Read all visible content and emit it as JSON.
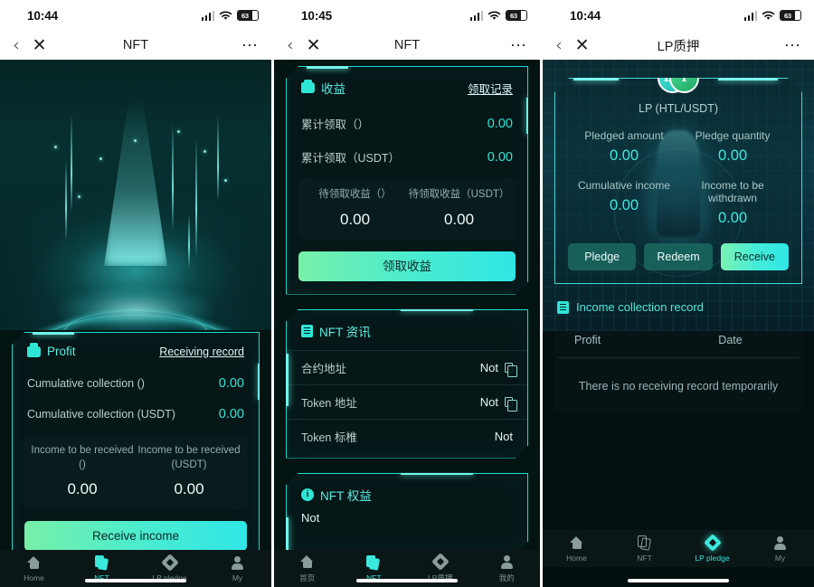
{
  "panels": [
    {
      "statusbar": {
        "time": "10:44",
        "battery": "63",
        "wifi_icon": "wifi-icon",
        "signal_icon": "signal-bars-icon"
      },
      "nav": {
        "back_icon": "chevron-left-icon",
        "close_icon": "close-x-icon",
        "title": "NFT",
        "more_icon": "more-dots-icon"
      },
      "profit_card": {
        "icon": "wallet-icon",
        "title": "Profit",
        "record_link": "Receiving record",
        "rows": [
          {
            "label": "Cumulative collection ()",
            "value": "0.00"
          },
          {
            "label": "Cumulative collection (USDT)",
            "value": "0.00"
          }
        ],
        "pending": [
          {
            "label": "Income to be received ()",
            "value": "0.00"
          },
          {
            "label": "Income to be received (USDT)",
            "value": "0.00"
          }
        ],
        "cta": "Receive income"
      },
      "tabs": [
        {
          "label": "Home",
          "icon": "home-icon",
          "active": false
        },
        {
          "label": "NFT",
          "icon": "nft-cards-icon",
          "active": true
        },
        {
          "label": "LP pledge",
          "icon": "lp-diamond-icon",
          "active": false
        },
        {
          "label": "My",
          "icon": "person-icon",
          "active": false
        }
      ]
    },
    {
      "statusbar": {
        "time": "10:45",
        "battery": "63",
        "wifi_icon": "wifi-icon",
        "signal_icon": "signal-bars-icon"
      },
      "nav": {
        "back_icon": "chevron-left-icon",
        "close_icon": "close-x-icon",
        "title": "NFT",
        "more_icon": "more-dots-icon"
      },
      "profit_card": {
        "icon": "wallet-icon",
        "title": "收益",
        "record_link": "领取记录",
        "rows": [
          {
            "label": "累计领取（）",
            "value": "0.00"
          },
          {
            "label": "累计领取（USDT）",
            "value": "0.00"
          }
        ],
        "pending": [
          {
            "label": "待领取收益（）",
            "value": "0.00"
          },
          {
            "label": "待领取收益（USDT）",
            "value": "0.00"
          }
        ],
        "cta": "领取收益"
      },
      "info_card": {
        "icon": "document-icon",
        "title": "NFT 资讯",
        "rows": [
          {
            "label": "合约地址",
            "value": "Not",
            "copy": true
          },
          {
            "label": "Token 地址",
            "value": "Not",
            "copy": true
          },
          {
            "label": "Token 标椎",
            "value": "Not",
            "copy": false
          }
        ]
      },
      "rights_card": {
        "icon": "info-icon",
        "title": "NFT 权益",
        "body": "Not"
      },
      "tabs": [
        {
          "label": "首页",
          "icon": "home-icon",
          "active": false
        },
        {
          "label": "NFT",
          "icon": "nft-cards-icon",
          "active": true
        },
        {
          "label": "LP质押",
          "icon": "lp-diamond-icon",
          "active": false
        },
        {
          "label": "我的",
          "icon": "person-icon",
          "active": false
        }
      ]
    },
    {
      "statusbar": {
        "time": "10:44",
        "battery": "63",
        "wifi_icon": "wifi-icon",
        "signal_icon": "signal-bars-icon"
      },
      "nav": {
        "back_icon": "chevron-left-icon",
        "close_icon": "close-x-icon",
        "title": "LP质押",
        "more_icon": "more-dots-icon"
      },
      "lp_card": {
        "logo_left": "lp-token-icon",
        "logo_right": "tether-token-icon",
        "logo_left_text": "LP",
        "logo_right_text": "T",
        "pair_name": "LP (HTL/USDT)",
        "stats": [
          {
            "label": "Pledged amount",
            "value": "0.00"
          },
          {
            "label": "Pledge quantity",
            "value": "0.00"
          },
          {
            "label": "Cumulative income",
            "value": "0.00"
          },
          {
            "label": "Income to be withdrawn",
            "value": "0.00"
          }
        ],
        "buttons": [
          {
            "label": "Pledge",
            "primary": false
          },
          {
            "label": "Redeem",
            "primary": false
          },
          {
            "label": "Receive",
            "primary": true
          }
        ]
      },
      "record_section": {
        "icon": "document-icon",
        "title": "Income collection record",
        "columns": [
          "Profit",
          "Date"
        ],
        "empty": "There is no receiving record temporarily"
      },
      "tabs": [
        {
          "label": "Home",
          "icon": "home-icon",
          "active": false
        },
        {
          "label": "NFT",
          "icon": "nft-cards-icon",
          "active": false
        },
        {
          "label": "LP pledge",
          "icon": "lp-diamond-icon",
          "active": true
        },
        {
          "label": "My",
          "icon": "person-icon",
          "active": false
        }
      ]
    }
  ],
  "theme": {
    "accent": "#2fe6d6",
    "accent_bright": "#6ff6ea",
    "bg": "#041412",
    "cta_start": "#77f0a8",
    "cta_end": "#2fe6e6"
  }
}
